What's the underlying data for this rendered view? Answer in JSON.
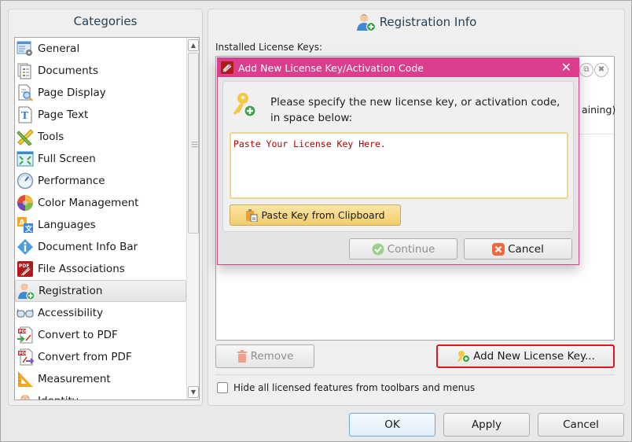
{
  "categories": {
    "title": "Categories",
    "items": [
      {
        "label": "General",
        "icon": "general-settings-icon",
        "selected": false
      },
      {
        "label": "Documents",
        "icon": "documents-icon",
        "selected": false
      },
      {
        "label": "Page Display",
        "icon": "page-display-icon",
        "selected": false
      },
      {
        "label": "Page Text",
        "icon": "page-text-icon",
        "selected": false
      },
      {
        "label": "Tools",
        "icon": "tools-icon",
        "selected": false
      },
      {
        "label": "Full Screen",
        "icon": "full-screen-icon",
        "selected": false
      },
      {
        "label": "Performance",
        "icon": "performance-icon",
        "selected": false
      },
      {
        "label": "Color Management",
        "icon": "color-management-icon",
        "selected": false
      },
      {
        "label": "Languages",
        "icon": "languages-icon",
        "selected": false
      },
      {
        "label": "Document Info Bar",
        "icon": "info-icon",
        "selected": false
      },
      {
        "label": "File Associations",
        "icon": "pdf-file-icon",
        "selected": false
      },
      {
        "label": "Registration",
        "icon": "user-add-icon",
        "selected": true
      },
      {
        "label": "Accessibility",
        "icon": "glasses-icon",
        "selected": false
      },
      {
        "label": "Convert to PDF",
        "icon": "convert-to-pdf-icon",
        "selected": false
      },
      {
        "label": "Convert from PDF",
        "icon": "convert-from-pdf-icon",
        "selected": false
      },
      {
        "label": "Measurement",
        "icon": "ruler-triangle-icon",
        "selected": false
      },
      {
        "label": "Identity",
        "icon": "identity-icon",
        "selected": false
      }
    ]
  },
  "registration": {
    "title": "Registration Info",
    "installed_label": "Installed License Keys:",
    "remaining_fragment": "aining)",
    "remove_label": "Remove",
    "add_key_label": "Add New License Key...",
    "hide_label": "Hide all licensed features from toolbars and menus",
    "hide_checked": false
  },
  "dialog": {
    "title": "Add New License Key/Activation Code",
    "message": "Please specify the new license key, or activation code, in space below:",
    "textarea_value": "Paste Your License Key Here.",
    "paste_label": "Paste Key from Clipboard",
    "continue_label": "Continue",
    "cancel_label": "Cancel"
  },
  "footer": {
    "ok_label": "OK",
    "apply_label": "Apply",
    "cancel_label": "Cancel"
  },
  "colors": {
    "dialog_titlebar": "#dc3d8c",
    "highlight_border": "#e8141b",
    "textarea_text": "#b00000"
  }
}
